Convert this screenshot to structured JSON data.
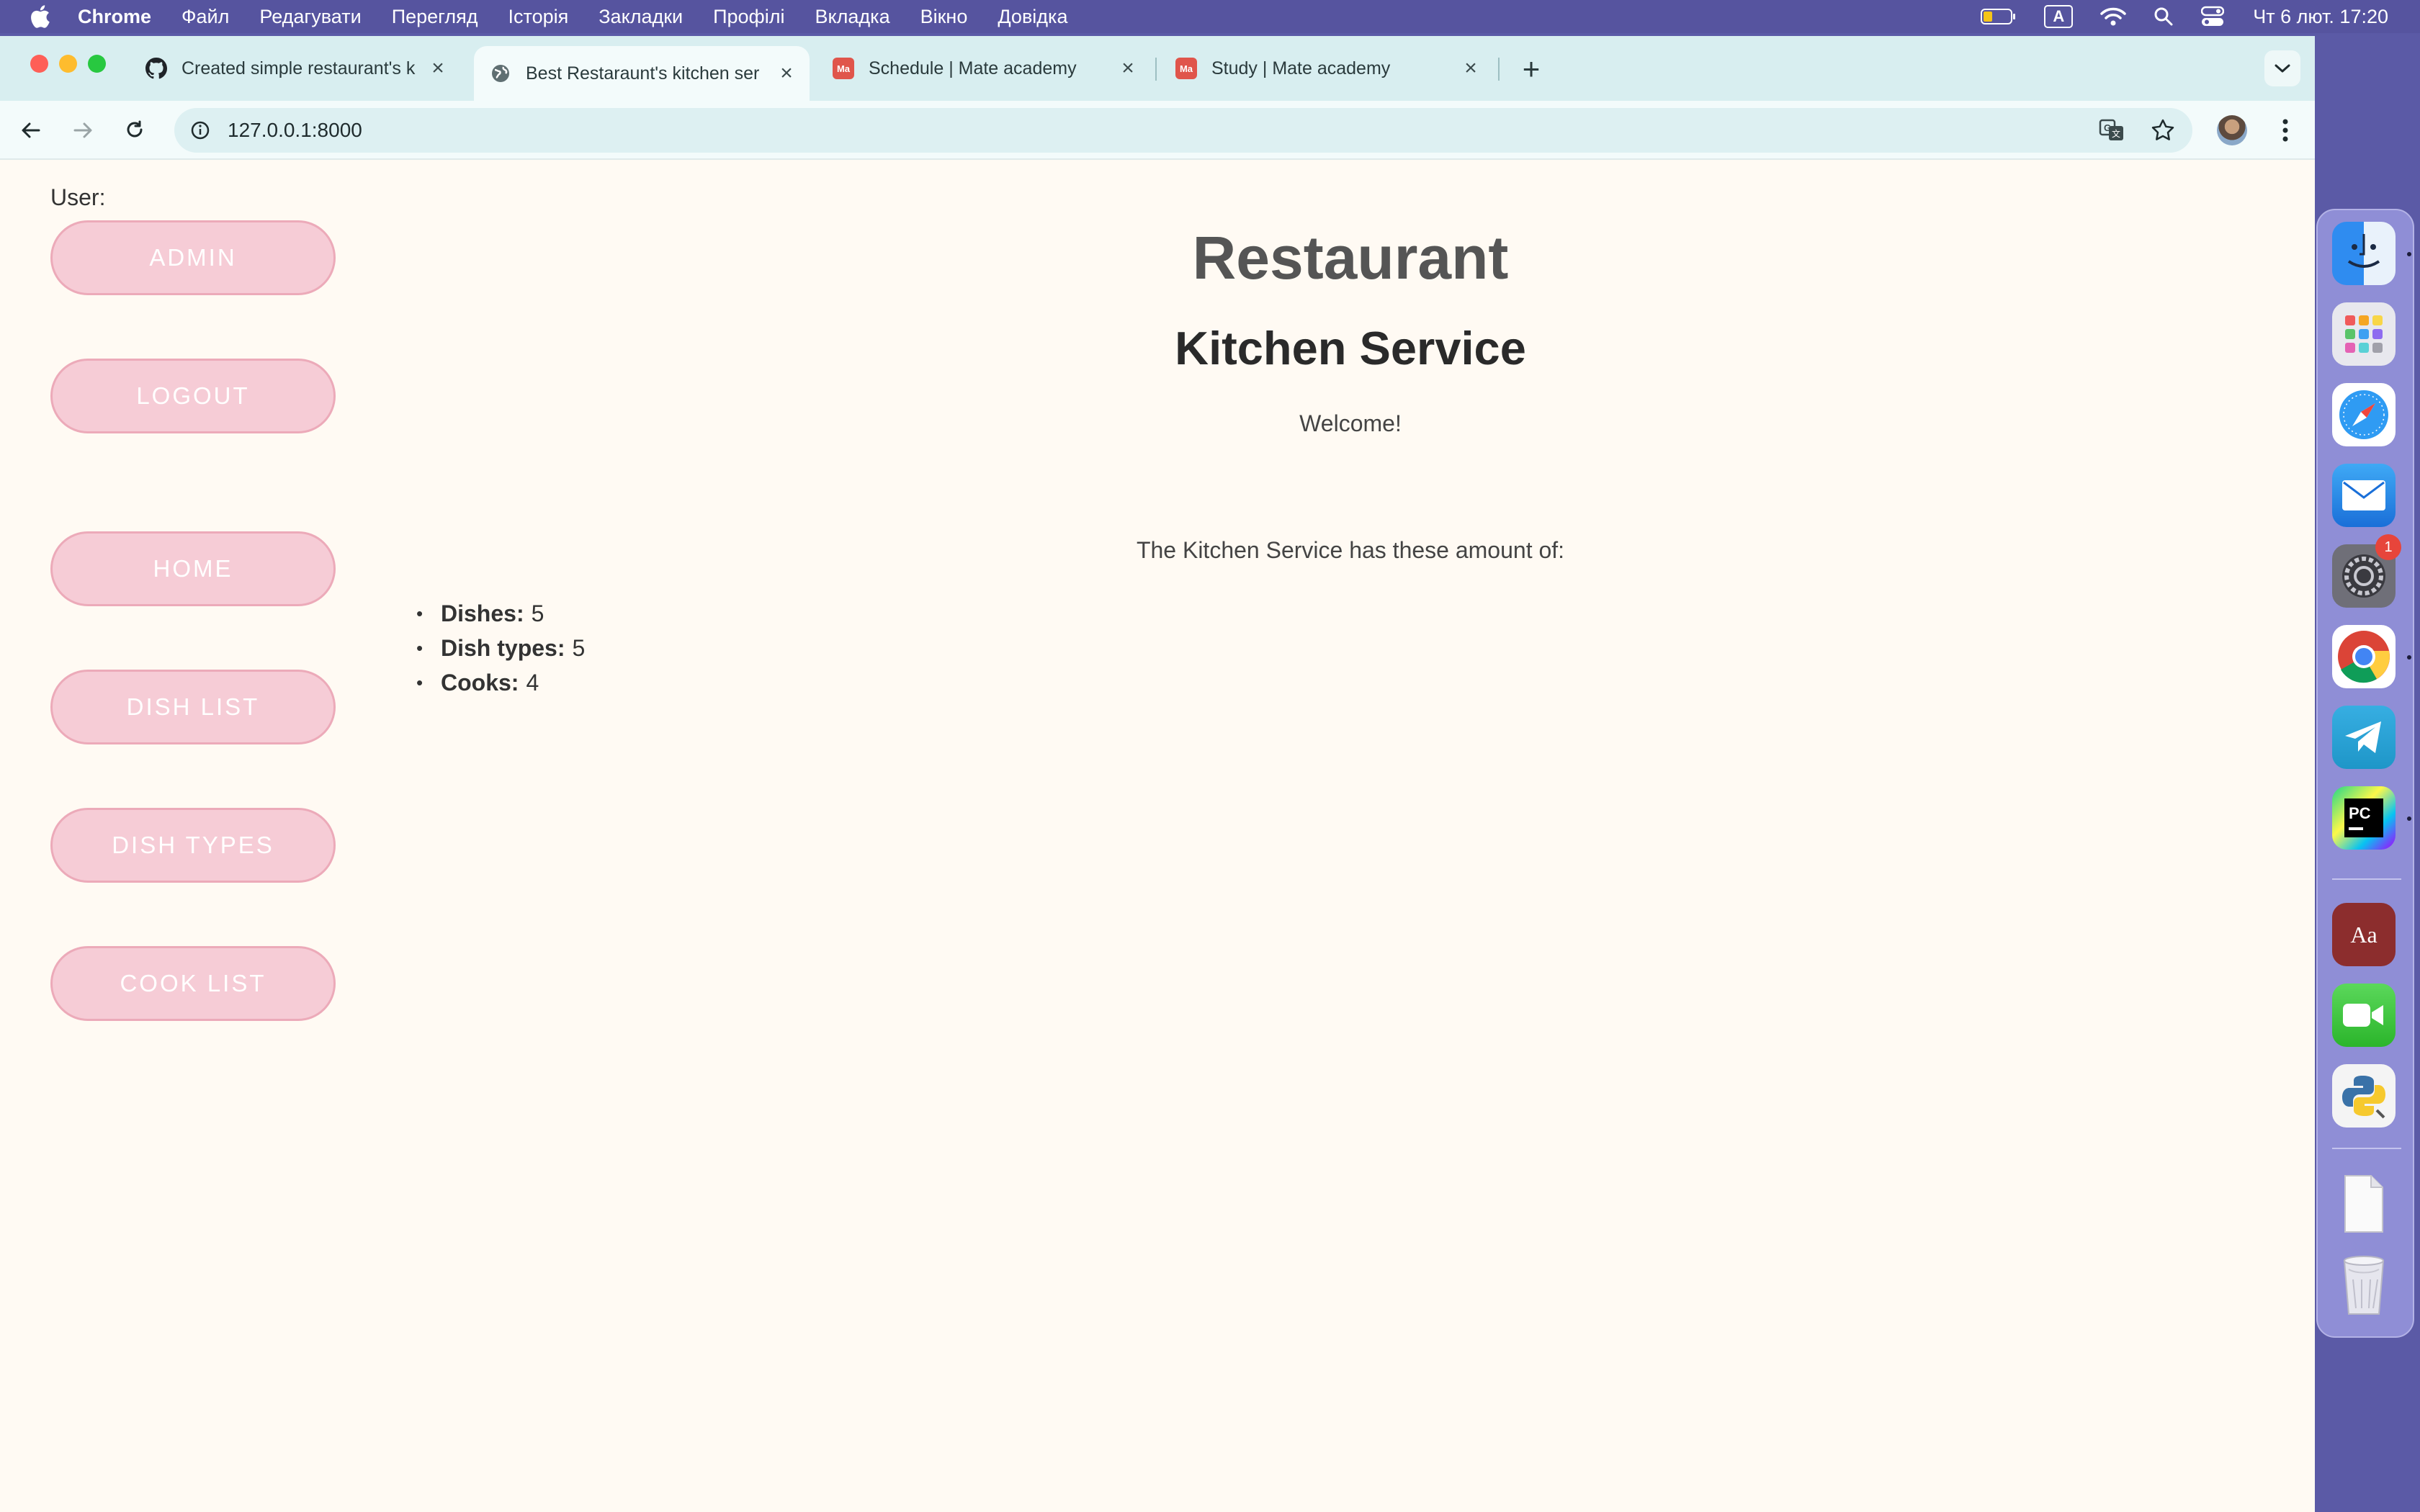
{
  "menubar": {
    "app_name": "Chrome",
    "items": [
      "Файл",
      "Редагувати",
      "Перегляд",
      "Історія",
      "Закладки",
      "Профілі",
      "Вкладка",
      "Вікно",
      "Довідка"
    ],
    "keyboard_layout": "A",
    "clock": "Чт 6 лют.  17:20"
  },
  "browser": {
    "tabs": [
      {
        "title": "Created simple restaurant's k",
        "icon": "github-icon",
        "active": false
      },
      {
        "title": "Best Restaraunt's kitchen ser",
        "icon": "globe-icon",
        "active": true
      },
      {
        "title": "Schedule | Mate academy",
        "icon": "mate-academy-icon",
        "active": false
      },
      {
        "title": "Study | Mate academy",
        "icon": "mate-academy-icon",
        "active": false
      }
    ],
    "address": "127.0.0.1:8000"
  },
  "sidebar": {
    "user_label": "User:",
    "buttons": [
      "Admin",
      "Logout",
      "Home",
      "Dish list",
      "Dish types",
      "Cook list"
    ]
  },
  "main": {
    "title": "Restaurant",
    "subtitle": "Kitchen Service",
    "welcome": "Welcome!",
    "amount_text": "The Kitchen Service has these amount of:",
    "counts": [
      {
        "label": "Dishes:",
        "value": "5"
      },
      {
        "label": "Dish types:",
        "value": "5"
      },
      {
        "label": "Cooks:",
        "value": "4"
      }
    ]
  },
  "dock": {
    "apps": [
      "finder-icon",
      "launchpad-icon",
      "safari-icon",
      "mail-icon",
      "system-settings-icon",
      "chrome-icon",
      "telegram-icon",
      "pycharm-icon",
      "dictionary-icon",
      "facetime-icon",
      "python-launcher-icon",
      "document-icon",
      "trash-icon"
    ],
    "settings_badge": "1"
  },
  "colors": {
    "menubar": "#56549f",
    "tabstrip": "#d8eef0",
    "page_bg": "#fffaf3",
    "nav_button_bg": "#f6ccd6",
    "nav_button_border": "#ecaab9"
  }
}
